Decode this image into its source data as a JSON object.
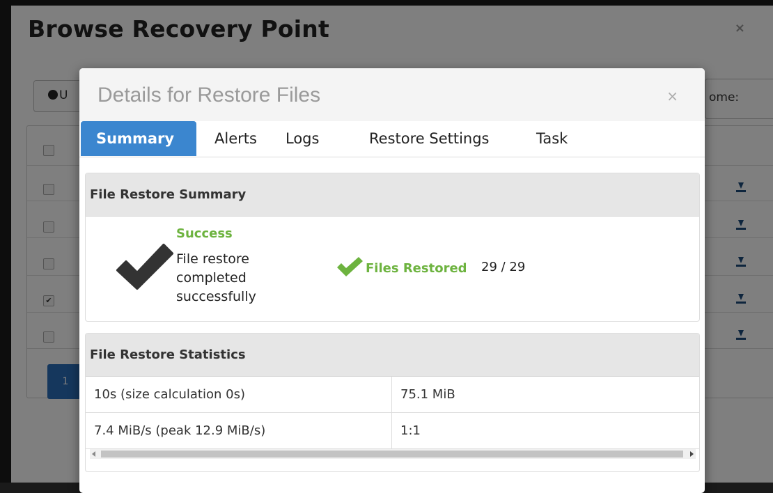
{
  "background": {
    "title": "Browse Recovery Point",
    "close_glyph": "×",
    "toolbar_button_label": "U",
    "right_label": "ome:",
    "pagination_current": "1",
    "rows": [
      {
        "checked": false
      },
      {
        "checked": false
      },
      {
        "checked": false
      },
      {
        "checked": false
      },
      {
        "checked": true
      },
      {
        "checked": false
      }
    ]
  },
  "modal": {
    "title": "Details for Restore Files",
    "close_glyph": "×",
    "tabs": [
      {
        "label": "Summary",
        "active": true
      },
      {
        "label": "Alerts",
        "active": false
      },
      {
        "label": "Logs",
        "active": false
      },
      {
        "label": "Restore Settings",
        "active": false
      },
      {
        "label": "Task",
        "active": false
      }
    ],
    "summary": {
      "heading": "File Restore Summary",
      "status": "Success",
      "message": "File restore completed successfully",
      "files_restored_label": "Files Restored",
      "files_restored_value": "29 / 29"
    },
    "statistics": {
      "heading": "File Restore Statistics",
      "rows": [
        [
          "10s (size calculation 0s)",
          "75.1 MiB"
        ],
        [
          "7.4 MiB/s (peak 12.9 MiB/s)",
          "1:1"
        ]
      ]
    }
  },
  "colors": {
    "accent": "#3b86cf",
    "success": "#6db33f",
    "download_icon": "#1d4a7a"
  }
}
